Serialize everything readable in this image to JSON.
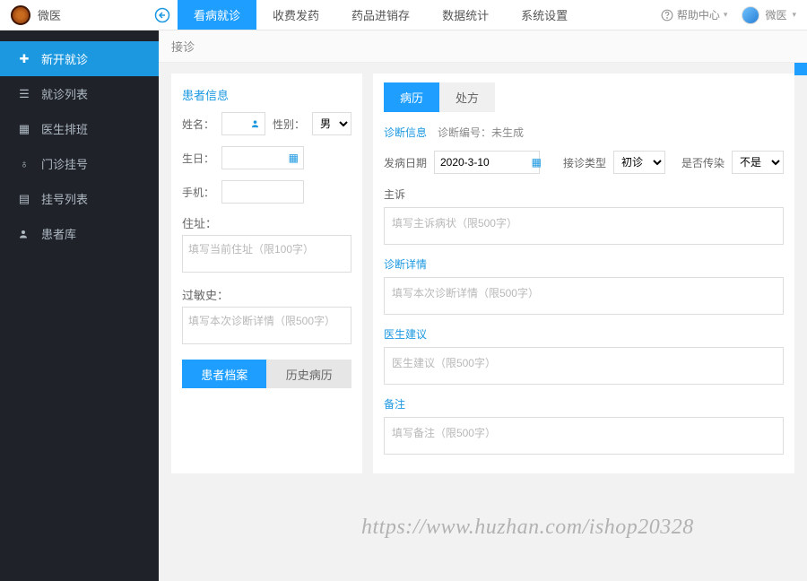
{
  "brand": "微医",
  "topnav": [
    {
      "label": "看病就诊",
      "active": true
    },
    {
      "label": "收费发药",
      "active": false
    },
    {
      "label": "药品进销存",
      "active": false
    },
    {
      "label": "数据统计",
      "active": false
    },
    {
      "label": "系统设置",
      "active": false
    }
  ],
  "help_label": "帮助中心",
  "user_label": "微医",
  "sidebar": [
    {
      "icon": "clipboard",
      "label": "新开就诊",
      "active": true
    },
    {
      "icon": "list",
      "label": "就诊列表",
      "active": false
    },
    {
      "icon": "calendar",
      "label": "医生排班",
      "active": false
    },
    {
      "icon": "register",
      "label": "门诊挂号",
      "active": false
    },
    {
      "icon": "table",
      "label": "挂号列表",
      "active": false
    },
    {
      "icon": "user",
      "label": "患者库",
      "active": false
    }
  ],
  "crumb": "接诊",
  "patient": {
    "title": "患者信息",
    "fields": {
      "name_label": "姓名：",
      "gender_label": "性别：",
      "gender_value": "男",
      "birth_label": "生日：",
      "phone_label": "手机：",
      "address_label": "住址：",
      "address_placeholder": "填写当前住址（限100字）",
      "allergy_label": "过敏史：",
      "allergy_placeholder": "填写本次诊断详情（限500字）"
    },
    "tabs": {
      "file": "患者档案",
      "history": "历史病历"
    }
  },
  "right": {
    "tabs": {
      "record": "病历",
      "prescription": "处方"
    },
    "diag_info_label": "诊断信息",
    "diag_no_label": "诊断编号：",
    "diag_no_value": "未生成",
    "onset_label": "发病日期",
    "onset_value": "2020-3-10",
    "visit_type_label": "接诊类型",
    "visit_type_value": "初诊",
    "infectious_label": "是否传染",
    "infectious_value": "不是",
    "chief_label": "主诉",
    "chief_placeholder": "填写主诉病状（限500字）",
    "diag_detail_label": "诊断详情",
    "diag_detail_placeholder": "填写本次诊断详情（限500字）",
    "advice_label": "医生建议",
    "advice_placeholder": "医生建议（限500字）",
    "remark_label": "备注",
    "remark_placeholder": "填写备注（限500字）"
  },
  "watermark": "https://www.huzhan.com/ishop20328",
  "colors": {
    "accent": "#1e9fff",
    "sidebar": "#20222a"
  }
}
